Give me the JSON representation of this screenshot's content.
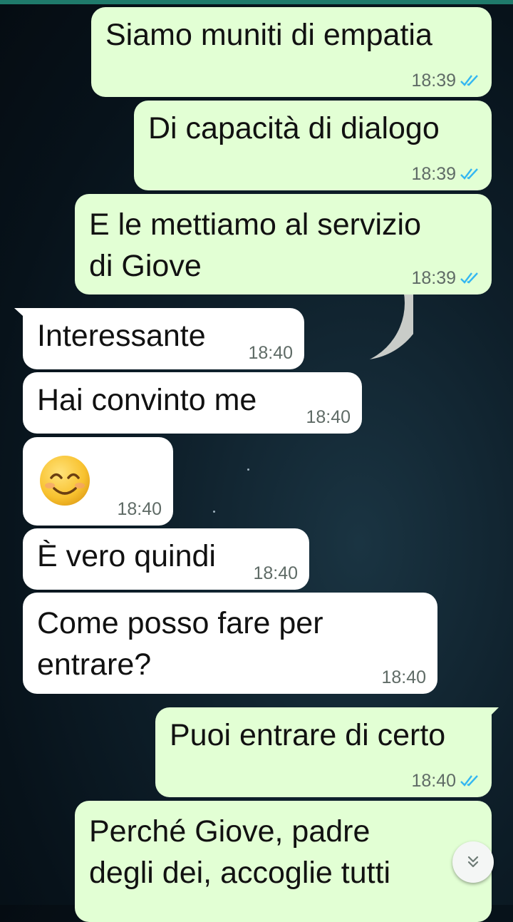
{
  "colors": {
    "outgoing_bubble": "#e2ffd4",
    "incoming_bubble": "#ffffff",
    "read_ticks": "#34b7f1",
    "wallpaper": "#07121a"
  },
  "messages": [
    {
      "direction": "outgoing",
      "text": "Siamo muniti di empatia",
      "time": "18:39",
      "status": "read"
    },
    {
      "direction": "outgoing",
      "text": "Di capacità di dialogo",
      "time": "18:39",
      "status": "read"
    },
    {
      "direction": "outgoing",
      "text": "E le mettiamo al servizio\ndi Giove",
      "time": "18:39",
      "status": "read"
    },
    {
      "direction": "incoming",
      "text": "Interessante",
      "time": "18:40"
    },
    {
      "direction": "incoming",
      "text": "Hai convinto me",
      "time": "18:40"
    },
    {
      "direction": "incoming",
      "text": "",
      "emoji": "smiling-face-with-smiling-eyes",
      "time": "18:40"
    },
    {
      "direction": "incoming",
      "text": "È vero quindi",
      "time": "18:40"
    },
    {
      "direction": "incoming",
      "text": "Come posso fare per\nentrare?",
      "time": "18:40"
    },
    {
      "direction": "outgoing",
      "text": "Puoi entrare di certo",
      "time": "18:40",
      "status": "read"
    },
    {
      "direction": "outgoing",
      "text": "Perché Giove, padre\ndegli dei, accoglie tutti",
      "time": "",
      "status": ""
    }
  ],
  "scroll_button": {
    "icon": "double-chevron-down-icon"
  }
}
